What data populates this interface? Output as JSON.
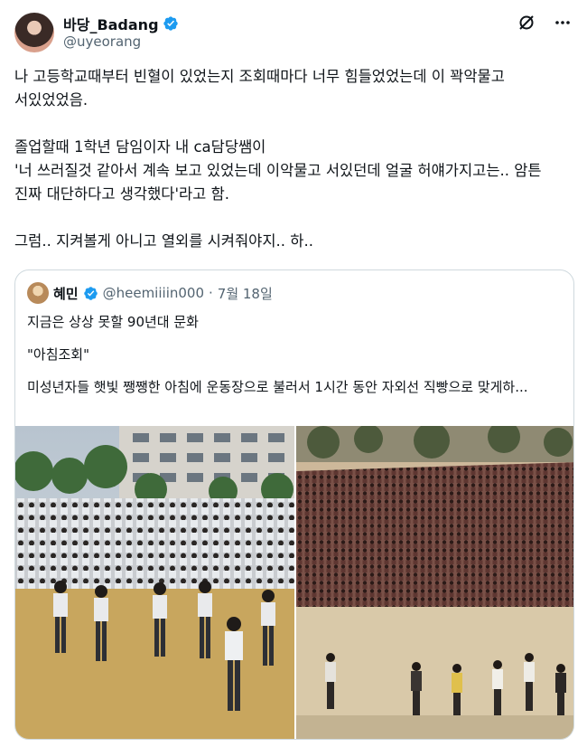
{
  "user": {
    "display_name": "바당_Badang",
    "handle": "@uyeorang"
  },
  "tweet": {
    "lines": [
      "나 고등학교때부터 빈혈이 있었는지 조회때마다 너무 힘들었었는데 이 꽉악물고 서있었었음.",
      "",
      "졸업할때 1학년 담임이자 내 ca담당쌤이",
      "'너 쓰러질것 같아서 계속 보고 있었는데 이악물고 서있던데 얼굴 허얘가지고는.. 암튼 진짜 대단하다고 생각했다'라고 함.",
      "",
      "그럼.. 지켜볼게 아니고 열외를 시켜줘야지.. 하.."
    ]
  },
  "quote": {
    "name": "혜민",
    "handle": "@heemiiiin000",
    "separator": "·",
    "date": "7월 18일",
    "paragraphs": [
      "지금은 상상 못할 90년대 문화",
      "\"아침조회\"",
      "미성년자들 햇빛 쨍쨍한 아침에 운동장으로 불러서 1시간 동안 자외선 직빵으로 맞게하..."
    ]
  },
  "colors": {
    "verified": "#1d9bf0",
    "secondary_text": "#536471",
    "border": "#cfd9de"
  },
  "icons": {
    "grok": "grok-icon",
    "more": "more-options-icon",
    "verified": "verified-badge-icon"
  }
}
